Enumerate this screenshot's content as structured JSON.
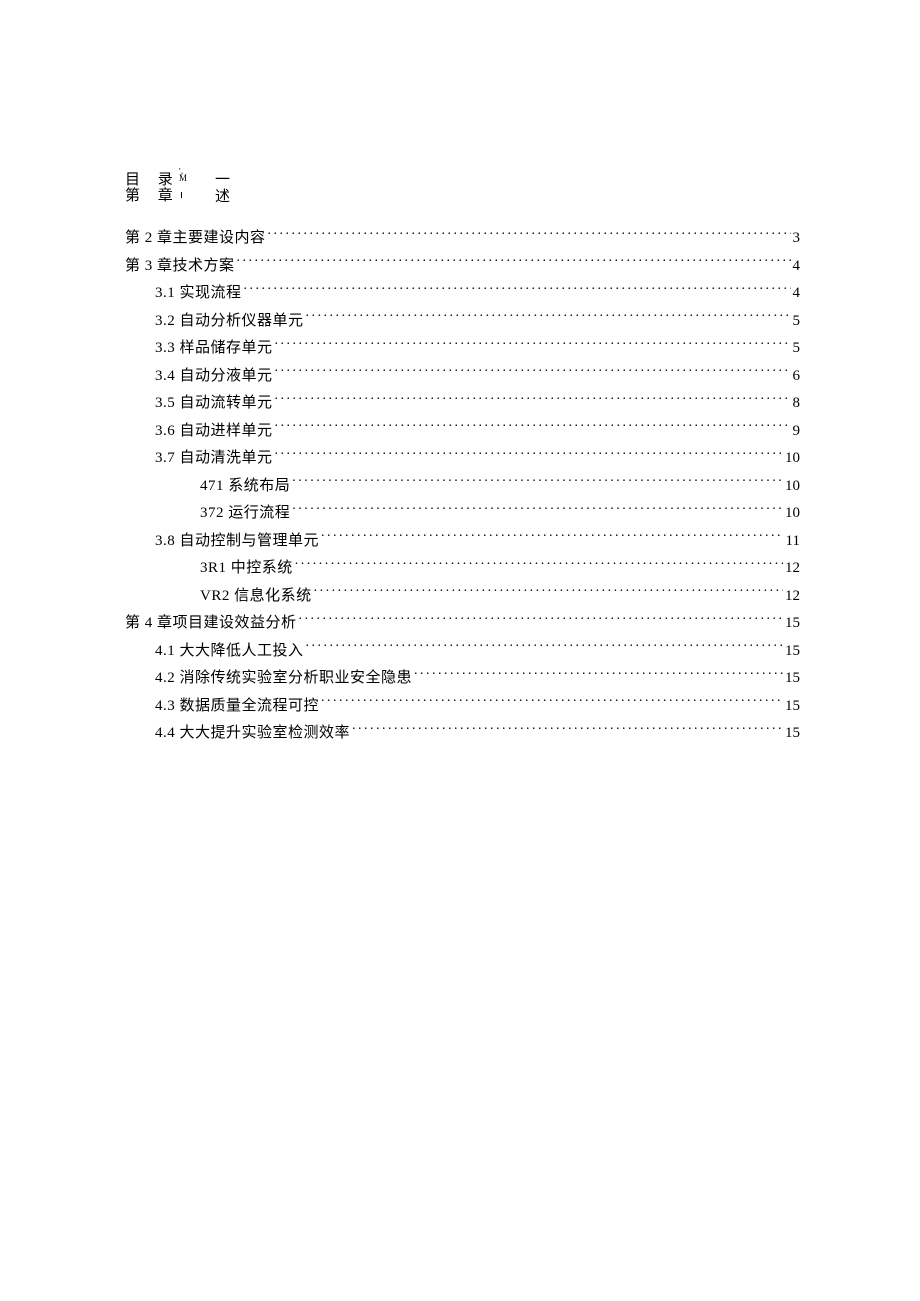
{
  "header": {
    "line1_left": "目 录",
    "line1_right": "一",
    "artifact_top": "' ,",
    "artifact_mid": "M",
    "line2_left": "第 章",
    "line2_mid_artifact": "|",
    "line2_right": "述"
  },
  "toc": [
    {
      "indent": 0,
      "label": "第 2 章主要建设内容",
      "page": "3"
    },
    {
      "indent": 0,
      "label": "第 3 章技术方案",
      "page": "4"
    },
    {
      "indent": 1,
      "label": "3.1 实现流程",
      "page": "4"
    },
    {
      "indent": 1,
      "label": "3.2 自动分析仪器单元",
      "page": "5"
    },
    {
      "indent": 1,
      "label": "3.3 样品储存单元",
      "page": "5"
    },
    {
      "indent": 1,
      "label": "3.4 自动分液单元",
      "page": "6"
    },
    {
      "indent": 1,
      "label": "3.5 自动流转单元",
      "page": "8"
    },
    {
      "indent": 1,
      "label": "3.6 自动进样单元",
      "page": "9"
    },
    {
      "indent": 1,
      "label": "3.7 自动清洗单元",
      "page": "10"
    },
    {
      "indent": 2,
      "label": "471 系统布局",
      "page": "10"
    },
    {
      "indent": 2,
      "label": "372 运行流程",
      "page": "10"
    },
    {
      "indent": 1,
      "label": "3.8 自动控制与管理单元",
      "page": "11"
    },
    {
      "indent": 2,
      "label": "3R1 中控系统",
      "page": "12"
    },
    {
      "indent": 2,
      "label": "VR2 信息化系统",
      "page": "12"
    },
    {
      "indent": 0,
      "label": "第 4 章项目建设效益分析",
      "page": "15"
    },
    {
      "indent": 1,
      "label": "4.1 大大降低人工投入",
      "page": "15"
    },
    {
      "indent": 1,
      "label": "4.2 消除传统实验室分析职业安全隐患",
      "page": "15"
    },
    {
      "indent": 1,
      "label": "4.3 数据质量全流程可控",
      "page": "15"
    },
    {
      "indent": 1,
      "label": "4.4 大大提升实验室检测效率",
      "page": "15"
    }
  ]
}
